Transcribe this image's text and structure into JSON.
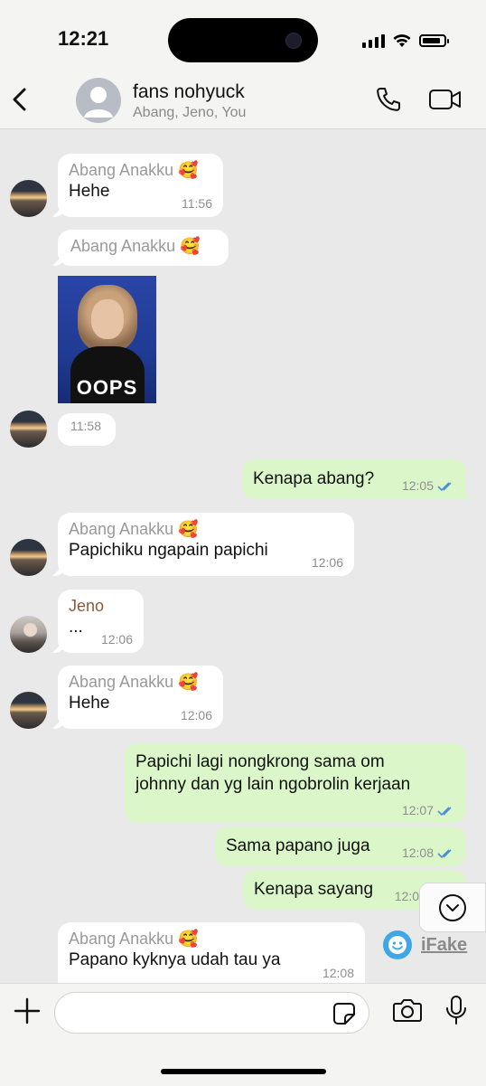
{
  "status_bar": {
    "time": "12:21"
  },
  "header": {
    "back_icon": "chevron-left-icon",
    "title": "fans nohyuck",
    "subtitle": "Abang, Jeno, You",
    "call_icon": "phone-icon",
    "video_icon": "video-camera-icon"
  },
  "messages": [
    {
      "direction": "in",
      "sender": "Abang Anakku 🥰",
      "text": "Hehe",
      "time": "11:56"
    },
    {
      "direction": "in",
      "sender": "Abang Anakku 🥰",
      "media": "gif",
      "media_caption": "OOPS",
      "time": "11:58"
    },
    {
      "direction": "out",
      "text": "Kenapa abang?",
      "time": "12:05",
      "status": "read"
    },
    {
      "direction": "in",
      "sender": "Abang Anakku 🥰",
      "text": "Papichiku ngapain papichi",
      "time": "12:06"
    },
    {
      "direction": "in",
      "sender": "Jeno",
      "text": "...",
      "time": "12:06"
    },
    {
      "direction": "in",
      "sender": "Abang Anakku 🥰",
      "text": "Hehe",
      "time": "12:06"
    },
    {
      "direction": "out",
      "text_line1": "Papichi lagi nongkrong sama om",
      "text_line2": "johnny dan yg lain ngobrolin kerjaan",
      "time": "12:07",
      "status": "read"
    },
    {
      "direction": "out",
      "text": "Sama papano juga",
      "time": "12:08",
      "status": "read"
    },
    {
      "direction": "out",
      "text": "Kenapa sayang",
      "time": "12:0",
      "status": "read"
    },
    {
      "direction": "in",
      "sender": "Abang Anakku 🥰",
      "text": "Papano kyknya udah tau ya",
      "time": "12:08"
    }
  ],
  "watermark": {
    "text": "iFake"
  },
  "input_bar": {
    "placeholder": "",
    "value": ""
  },
  "colors": {
    "incoming": "#ffffff",
    "outgoing": "#dbf6c8",
    "background": "#e9e9e9",
    "tick": "#4a90d9",
    "jeno_name": "#8a5a3c"
  }
}
